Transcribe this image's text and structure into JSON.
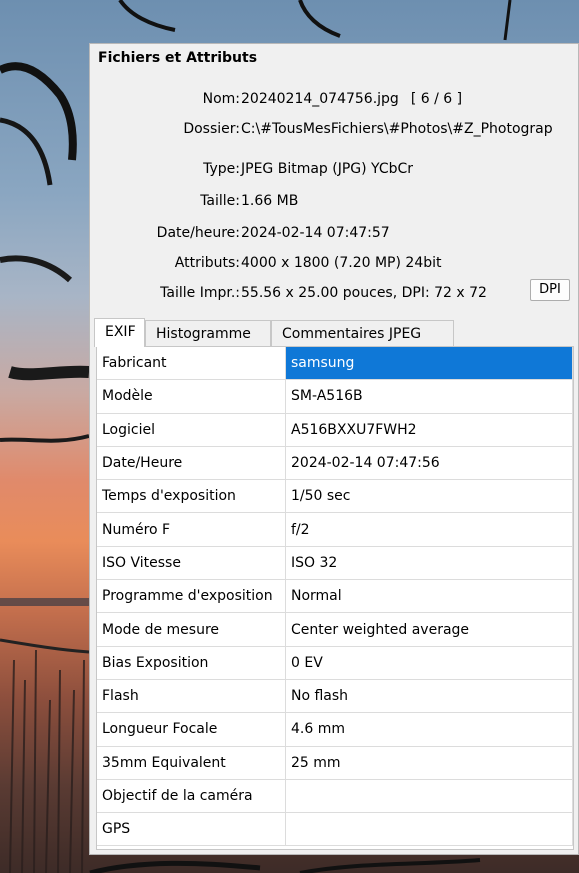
{
  "panel": {
    "title": "Fichiers et Attributs",
    "dpi_button": "DPI"
  },
  "info": [
    {
      "label": "Nom:",
      "value": "20240214_074756.jpg",
      "extra": "[ 6 / 6 ]"
    },
    {
      "label": "Dossier:",
      "value": "C:\\#TousMesFichiers\\#Photos\\#Z_Photograp"
    },
    {
      "label": "Type:",
      "value": "JPEG Bitmap (JPG) YCbCr"
    },
    {
      "label": "Taille:",
      "value": "1.66 MB"
    },
    {
      "label": "Date/heure:",
      "value": "2024-02-14 07:47:57"
    },
    {
      "label": "Attributs:",
      "value": "4000 x 1800 (7.20 MP)  24bit"
    },
    {
      "label": "Taille Impr.:",
      "value": "55.56 x 25.00 pouces,  DPI: 72 x 72"
    }
  ],
  "tabs": [
    {
      "label": "EXIF",
      "active": true
    },
    {
      "label": "Histogramme",
      "active": false
    },
    {
      "label": "Commentaires JPEG",
      "active": false
    }
  ],
  "exif_rows": [
    {
      "key": "Fabricant",
      "value": "samsung",
      "selected": true
    },
    {
      "key": "Modèle",
      "value": "SM-A516B"
    },
    {
      "key": "Logiciel",
      "value": "A516BXXU7FWH2"
    },
    {
      "key": "Date/Heure",
      "value": "2024-02-14 07:47:56"
    },
    {
      "key": "Temps d'exposition",
      "value": "1/50 sec"
    },
    {
      "key": "Numéro F",
      "value": "f/2"
    },
    {
      "key": "ISO Vitesse",
      "value": "ISO 32"
    },
    {
      "key": "Programme d'exposition",
      "value": "Normal"
    },
    {
      "key": "Mode de mesure",
      "value": "Center weighted average"
    },
    {
      "key": "Bias Exposition",
      "value": "0 EV"
    },
    {
      "key": "Flash",
      "value": "No flash"
    },
    {
      "key": "Longueur Focale",
      "value": "4.6 mm"
    },
    {
      "key": "35mm Equivalent",
      "value": "25 mm"
    },
    {
      "key": "Objectif de la caméra",
      "value": ""
    },
    {
      "key": "GPS",
      "value": ""
    }
  ],
  "colors": {
    "selection": "#0f78d7",
    "panel_bg": "#f0f0f0"
  }
}
